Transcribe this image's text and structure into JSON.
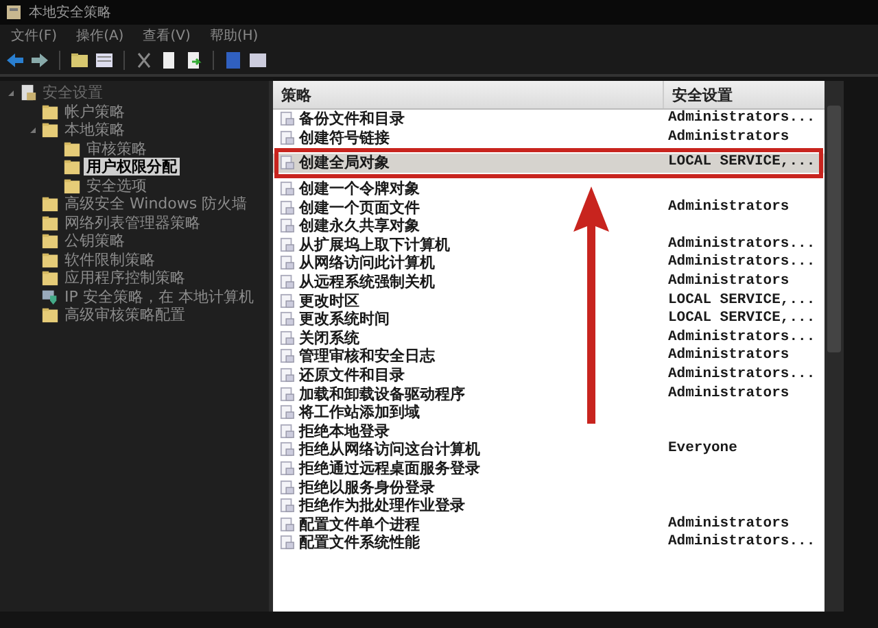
{
  "window": {
    "title": "本地安全策略"
  },
  "menu": [
    "文件(F)",
    "操作(A)",
    "查看(V)",
    "帮助(H)"
  ],
  "tree": [
    {
      "label": "安全设置",
      "kind": "root",
      "expanded": true,
      "selected": false,
      "children": [
        {
          "label": "帐户策略",
          "kind": "folder",
          "selected": false
        },
        {
          "label": "本地策略",
          "kind": "folder",
          "expanded": true,
          "selected": false,
          "children": [
            {
              "label": "审核策略",
              "kind": "folder",
              "selected": false
            },
            {
              "label": "用户权限分配",
              "kind": "folder",
              "selected": true
            },
            {
              "label": "安全选项",
              "kind": "folder",
              "selected": false
            }
          ]
        },
        {
          "label": "高级安全 Windows 防火墙",
          "kind": "folder",
          "selected": false
        },
        {
          "label": "网络列表管理器策略",
          "kind": "folder",
          "selected": false
        },
        {
          "label": "公钥策略",
          "kind": "folder",
          "selected": false
        },
        {
          "label": "软件限制策略",
          "kind": "folder",
          "selected": false
        },
        {
          "label": "应用程序控制策略",
          "kind": "folder",
          "selected": false
        },
        {
          "label": "IP 安全策略，在 本地计算机",
          "kind": "ip",
          "selected": false
        },
        {
          "label": "高级审核策略配置",
          "kind": "folder",
          "selected": false
        }
      ]
    }
  ],
  "table": {
    "columns": [
      "策略",
      "安全设置"
    ],
    "rows": [
      {
        "policy": "备份文件和目录",
        "setting": "Administrators...",
        "selected": false
      },
      {
        "policy": "创建符号链接",
        "setting": "Administrators",
        "selected": false
      },
      {
        "policy": "创建全局对象",
        "setting": "LOCAL SERVICE,...",
        "selected": true
      },
      {
        "policy": "创建一个令牌对象",
        "selected": false
      },
      {
        "policy": "创建一个页面文件",
        "setting": "Administrators",
        "selected": false
      },
      {
        "policy": "创建永久共享对象",
        "selected": false
      },
      {
        "policy": "从扩展坞上取下计算机",
        "setting": "Administrators...",
        "selected": false
      },
      {
        "policy": "从网络访问此计算机",
        "setting": "Administrators...",
        "selected": false
      },
      {
        "policy": "从远程系统强制关机",
        "setting": "Administrators",
        "selected": false
      },
      {
        "policy": "更改时区",
        "setting": "LOCAL SERVICE,...",
        "selected": false
      },
      {
        "policy": "更改系统时间",
        "setting": "LOCAL SERVICE,...",
        "selected": false
      },
      {
        "policy": "关闭系统",
        "setting": "Administrators...",
        "selected": false
      },
      {
        "policy": "管理审核和安全日志",
        "setting": "Administrators",
        "selected": false
      },
      {
        "policy": "还原文件和目录",
        "setting": "Administrators...",
        "selected": false
      },
      {
        "policy": "加载和卸载设备驱动程序",
        "setting": "Administrators",
        "selected": false
      },
      {
        "policy": "将工作站添加到域",
        "selected": false
      },
      {
        "policy": "拒绝本地登录",
        "selected": false
      },
      {
        "policy": "拒绝从网络访问这台计算机",
        "setting": "Everyone",
        "selected": false
      },
      {
        "policy": "拒绝通过远程桌面服务登录",
        "selected": false
      },
      {
        "policy": "拒绝以服务身份登录",
        "selected": false
      },
      {
        "policy": "拒绝作为批处理作业登录",
        "selected": false
      },
      {
        "policy": "配置文件单个进程",
        "setting": "Administrators",
        "selected": false
      },
      {
        "policy": "配置文件系统性能",
        "setting": "Administrators...",
        "selected": false
      }
    ]
  }
}
